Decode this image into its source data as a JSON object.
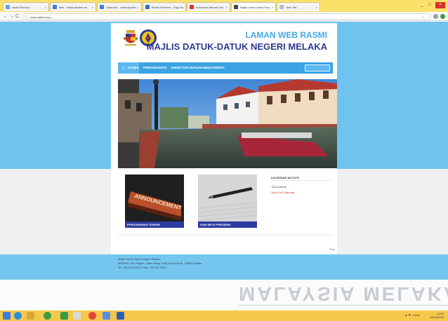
{
  "browser": {
    "tabs": [
      {
        "label": "chaff Directory",
        "fav": "#6a9ee0"
      },
      {
        "label": "Mail - sofian@utem.ed",
        "fav": "#3b7dd8"
      },
      {
        "label": "Calendar - sofian@utem",
        "fav": "#3b7dd8"
      },
      {
        "label": "Berita Parlimen - Pagi Sa",
        "fav": "#2a6fc0"
      },
      {
        "label": "Indonesia Bersatu Ma",
        "fav": "#d9332b"
      },
      {
        "label": "Majlis Datuk-Datuk Neg",
        "fav": "#444444"
      },
      {
        "label": "New Tab",
        "fav": "#bbbbbb"
      }
    ],
    "url": "www.mddnm.my",
    "back": "←",
    "forward": "→",
    "reload": "C",
    "star": "☆",
    "minimize": "_",
    "maximize": "□",
    "close": "×"
  },
  "site": {
    "title_small": "LAMAN WEB RASMI",
    "title_main": "MAJLIS DATUK-DATUK NEGERI MELAKA",
    "nav": {
      "home": "UTAMA",
      "items": [
        "PENGUMUMAN",
        "DIREKTORI DUKUNAN",
        "MULTIMEDIA"
      ]
    },
    "cards": [
      {
        "caption": "PENGUMUMAN TERKINI",
        "word": "ANNOUNCEMENT"
      },
      {
        "caption": "DARI MEJA PRESIDEN",
        "word": ""
      }
    ],
    "calendar": {
      "title": "KALENDAR AKTIVITI",
      "empty": "Tiada aktiviti",
      "link": "View Full Calendar"
    },
    "top_link": "Top",
    "footer": [
      "Majlis Datuk-Datuk Negeri Melaka",
      "MDDNM, Seri Negeri, Jalan Hang Tuah, Ayer Keroh, 75450 Melaka",
      "Tel : 06-233 3333 | Faks : 06-232 3333"
    ],
    "watermark": "MALAYSIA MELAKA"
  },
  "taskbar": {
    "icons": [
      "#3b7dd8",
      "#2a8fd6",
      "#d9a53b",
      "#3a9b45",
      "#4a6fc8",
      "#e04836",
      "#5a8de0",
      "#2b5fae"
    ],
    "tray": "▲ ⚑ ♪ ENG",
    "time": "11:07",
    "date": "24/03/2016"
  },
  "colors": {
    "accent_blue": "#3aa3e3",
    "title_light": "#45a9e2",
    "title_dark": "#2d3990",
    "card_caption": "#2b3ba0"
  }
}
